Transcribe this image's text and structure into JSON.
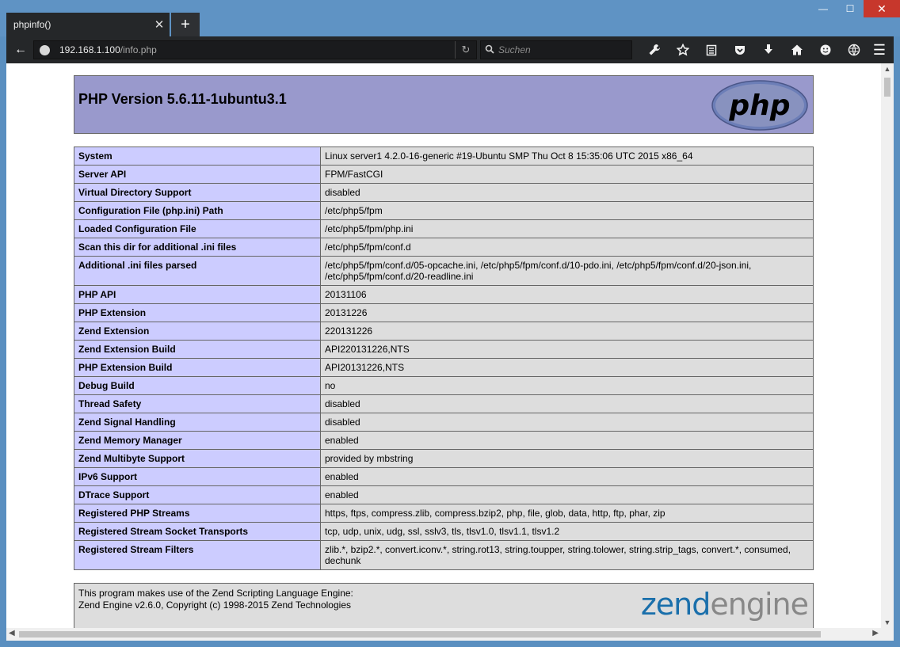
{
  "window": {
    "minimize": "—",
    "maximize": "☐",
    "close": "✕"
  },
  "tab": {
    "title": "phpinfo()",
    "close": "✕",
    "new": "+"
  },
  "nav": {
    "back": "←",
    "url_host": "192.168.1.100",
    "url_path": "/info.php",
    "reload": "↻",
    "search_placeholder": "Suchen",
    "menu": "☰"
  },
  "toolbar_icons": [
    "wrench-icon",
    "star-icon",
    "reading-list-icon",
    "pocket-icon",
    "download-icon",
    "home-icon",
    "smiley-icon",
    "globe-icon"
  ],
  "php": {
    "version_title": "PHP Version 5.6.11-1ubuntu3.1",
    "logo_text": "php",
    "rows": [
      {
        "key": "System",
        "value": "Linux server1 4.2.0-16-generic #19-Ubuntu SMP Thu Oct 8 15:35:06 UTC 2015 x86_64"
      },
      {
        "key": "Server API",
        "value": "FPM/FastCGI"
      },
      {
        "key": "Virtual Directory Support",
        "value": "disabled"
      },
      {
        "key": "Configuration File (php.ini) Path",
        "value": "/etc/php5/fpm"
      },
      {
        "key": "Loaded Configuration File",
        "value": "/etc/php5/fpm/php.ini"
      },
      {
        "key": "Scan this dir for additional .ini files",
        "value": "/etc/php5/fpm/conf.d"
      },
      {
        "key": "Additional .ini files parsed",
        "value": "/etc/php5/fpm/conf.d/05-opcache.ini, /etc/php5/fpm/conf.d/10-pdo.ini, /etc/php5/fpm/conf.d/20-json.ini, /etc/php5/fpm/conf.d/20-readline.ini"
      },
      {
        "key": "PHP API",
        "value": "20131106"
      },
      {
        "key": "PHP Extension",
        "value": "20131226"
      },
      {
        "key": "Zend Extension",
        "value": "220131226"
      },
      {
        "key": "Zend Extension Build",
        "value": "API220131226,NTS"
      },
      {
        "key": "PHP Extension Build",
        "value": "API20131226,NTS"
      },
      {
        "key": "Debug Build",
        "value": "no"
      },
      {
        "key": "Thread Safety",
        "value": "disabled"
      },
      {
        "key": "Zend Signal Handling",
        "value": "disabled"
      },
      {
        "key": "Zend Memory Manager",
        "value": "enabled"
      },
      {
        "key": "Zend Multibyte Support",
        "value": "provided by mbstring"
      },
      {
        "key": "IPv6 Support",
        "value": "enabled"
      },
      {
        "key": "DTrace Support",
        "value": "enabled"
      },
      {
        "key": "Registered PHP Streams",
        "value": "https, ftps, compress.zlib, compress.bzip2, php, file, glob, data, http, ftp, phar, zip"
      },
      {
        "key": "Registered Stream Socket Transports",
        "value": "tcp, udp, unix, udg, ssl, sslv3, tls, tlsv1.0, tlsv1.1, tlsv1.2"
      },
      {
        "key": "Registered Stream Filters",
        "value": "zlib.*, bzip2.*, convert.iconv.*, string.rot13, string.toupper, string.tolower, string.strip_tags, convert.*, consumed, dechunk"
      }
    ],
    "zend_line1": "This program makes use of the Zend Scripting Language Engine:",
    "zend_line2": "Zend Engine v2.6.0, Copyright (c) 1998-2015 Zend Technologies",
    "zend_logo_a": "zend",
    "zend_logo_b": "engine"
  }
}
